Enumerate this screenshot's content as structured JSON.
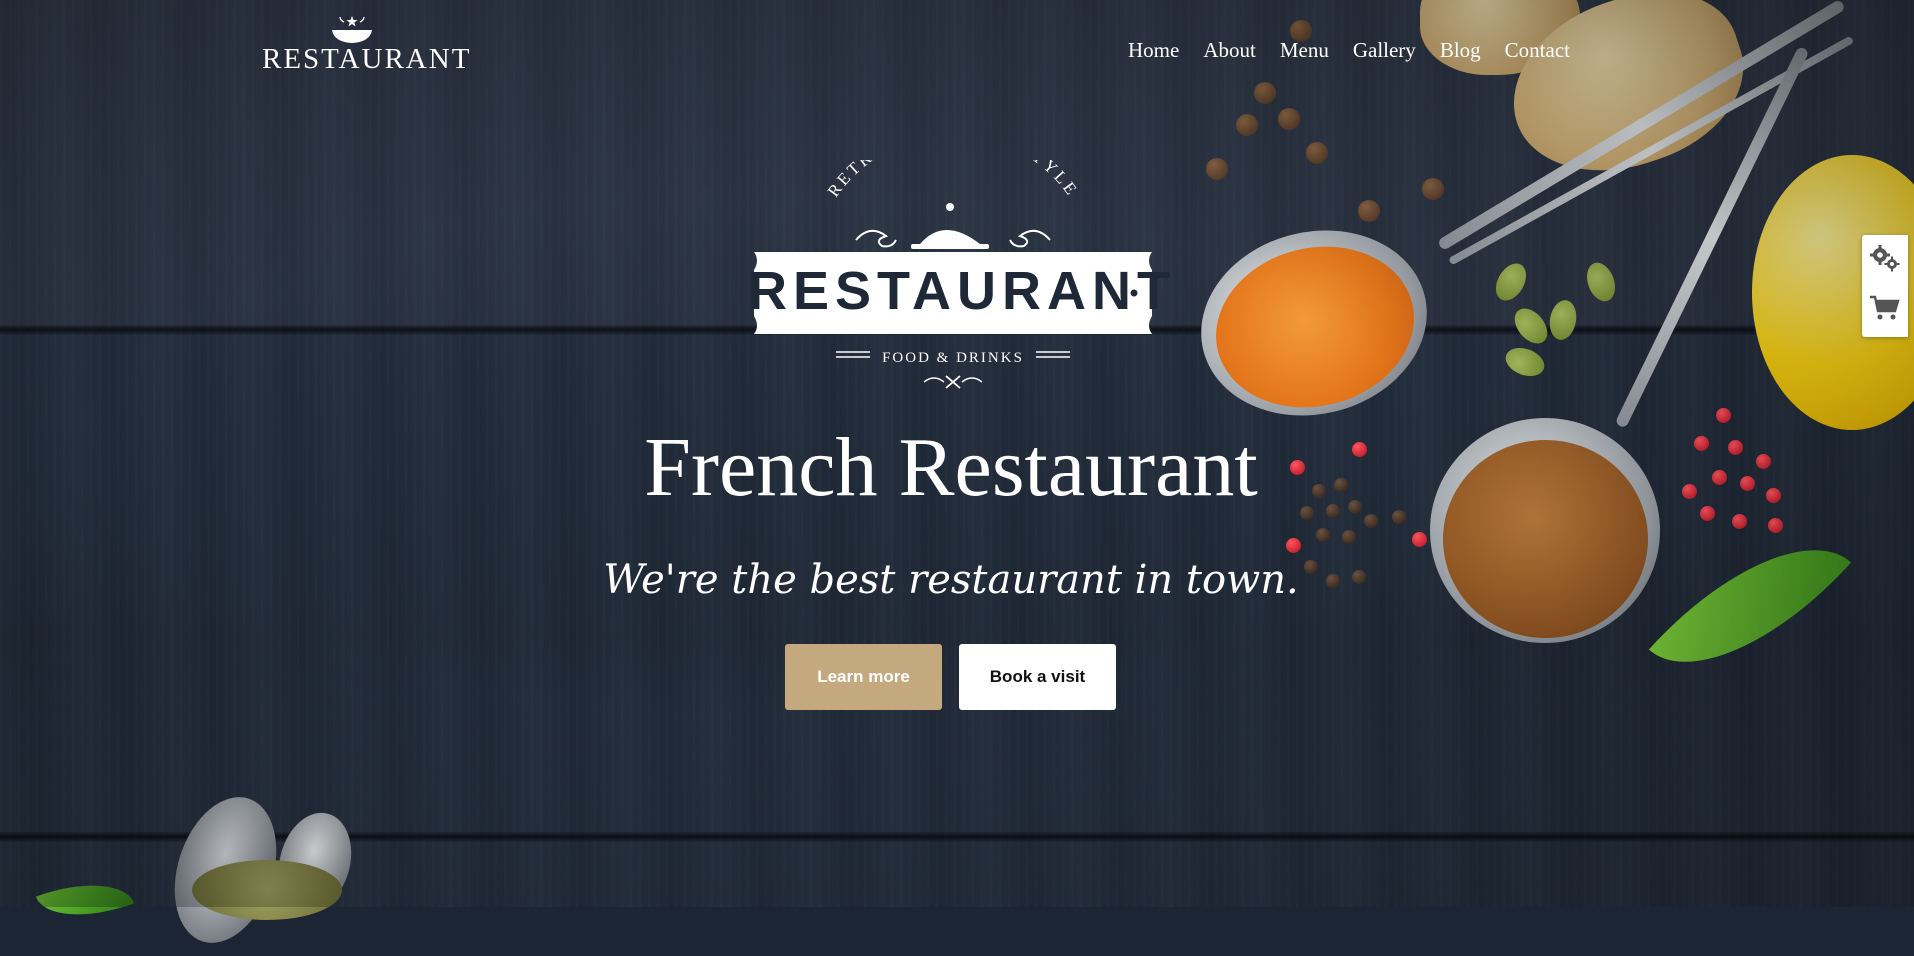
{
  "header": {
    "logo_text": "RESTAURANT",
    "nav": [
      {
        "label": "Home",
        "active": true
      },
      {
        "label": "About",
        "active": false
      },
      {
        "label": "Menu",
        "active": false
      },
      {
        "label": "Gallery",
        "active": false
      },
      {
        "label": "Blog",
        "active": false
      },
      {
        "label": "Contact",
        "active": false
      }
    ]
  },
  "badge": {
    "arc_text": "RETRO AUTHENTIC STYLE",
    "title": "RESTAURANT",
    "subtitle": "FOOD & DRINKS"
  },
  "hero": {
    "title": "French Restaurant",
    "tagline": "We're the best restaurant in town.",
    "learn_more_label": "Learn more",
    "book_label": "Book a visit"
  },
  "side_tools": [
    {
      "icon": "gears-icon"
    },
    {
      "icon": "cart-icon"
    }
  ],
  "colors": {
    "accent": "#c5a97e",
    "background": "#222c3b",
    "text": "#ffffff"
  }
}
